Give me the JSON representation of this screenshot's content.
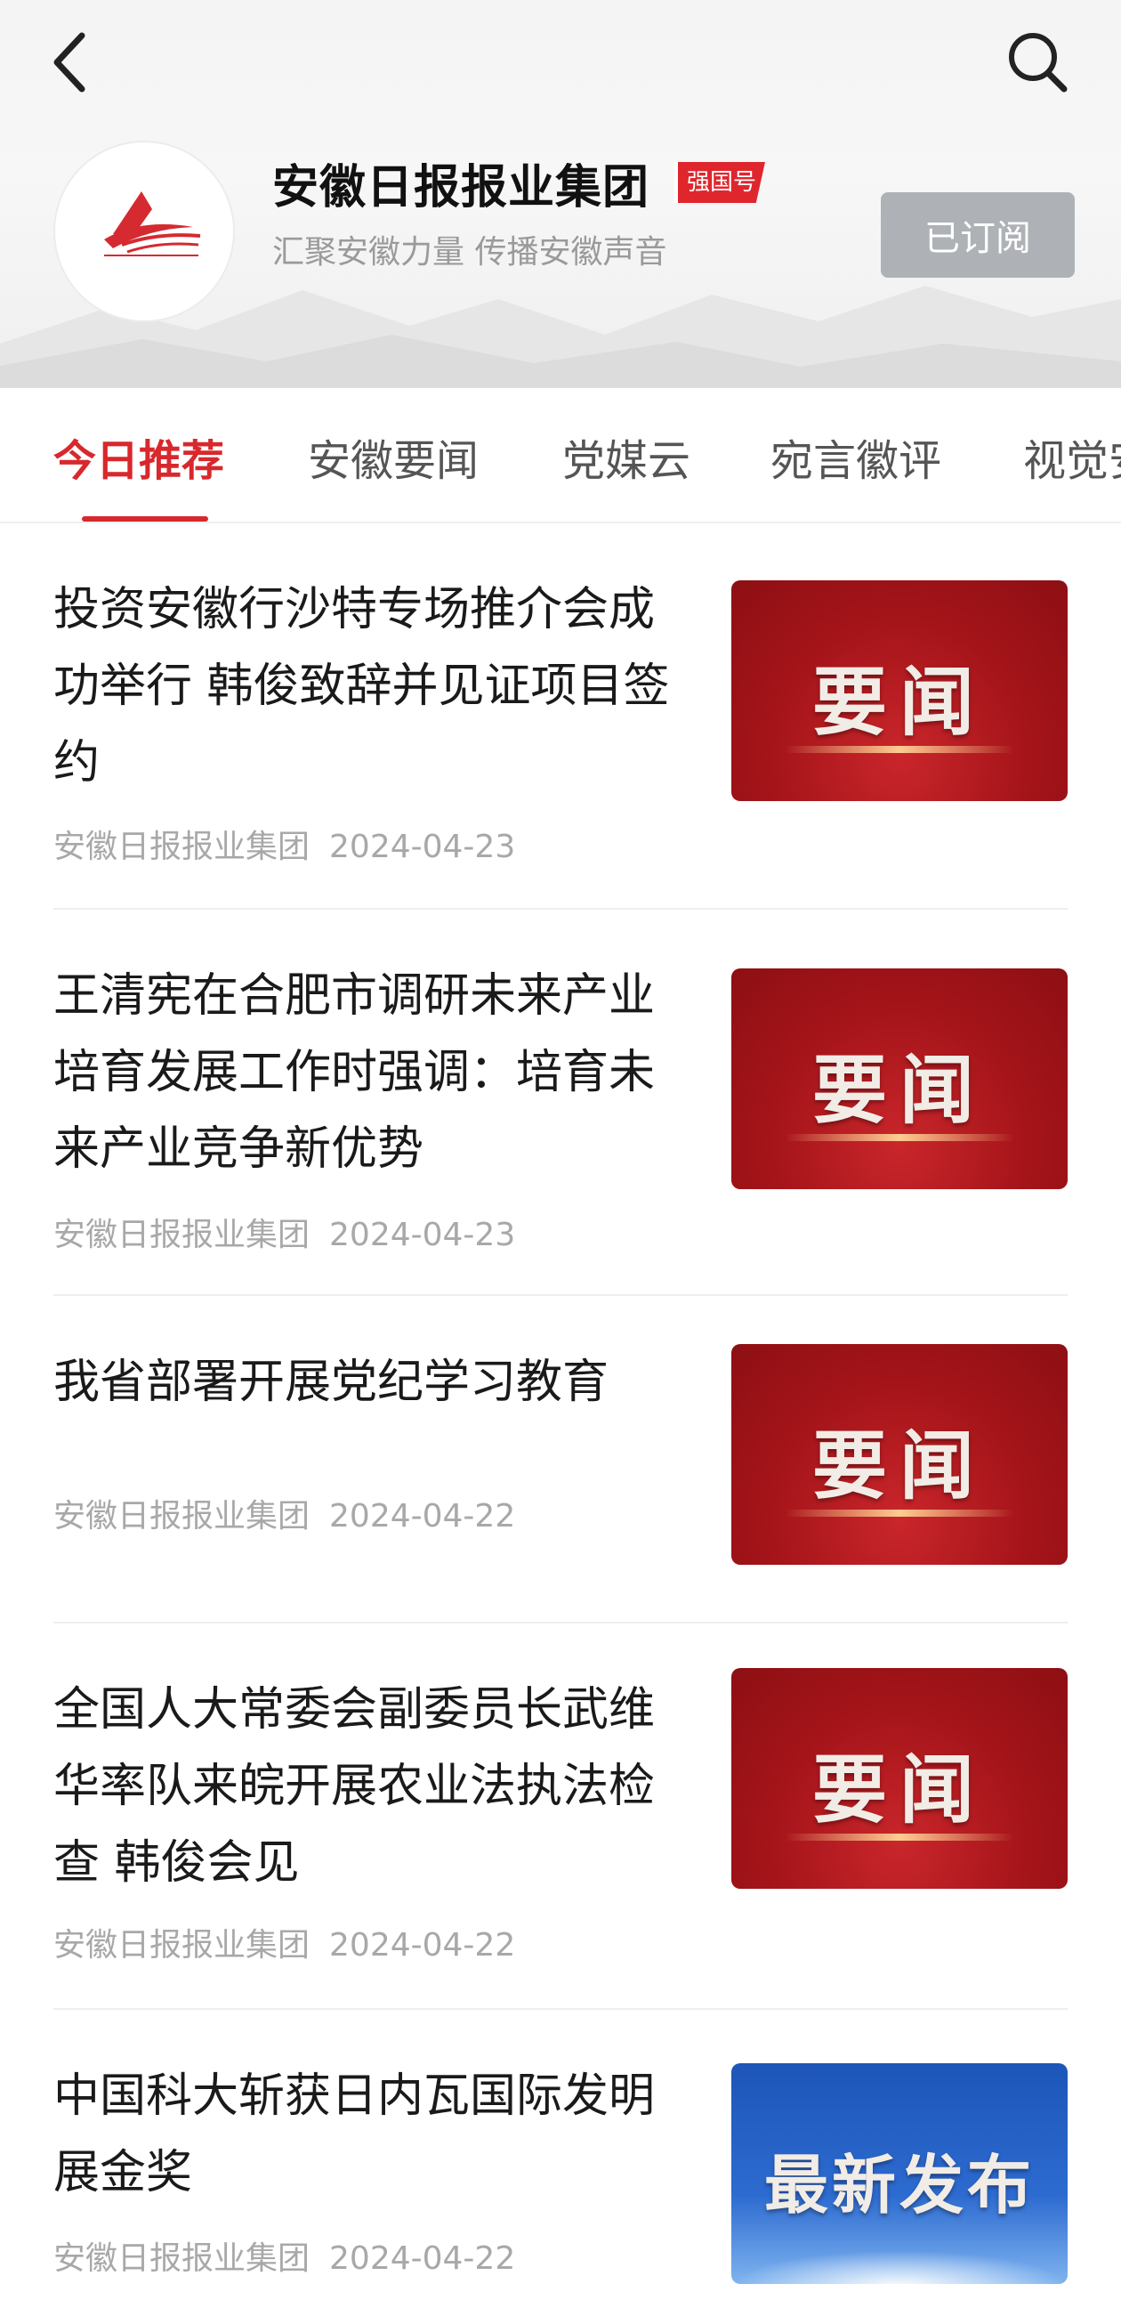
{
  "header": {
    "back_icon": "chevron-left-icon",
    "search_icon": "search-icon",
    "org_name": "安徽日报报业集团",
    "org_badge": "强国号",
    "slogan": "汇聚安徽力量 传播安徽声音",
    "subscribe_label": "已订阅",
    "logo_text": "安徽日报报业集团",
    "accent_color": "#d8282d"
  },
  "tabs": [
    {
      "label": "今日推荐",
      "active": true
    },
    {
      "label": "安徽要闻",
      "active": false
    },
    {
      "label": "党媒云",
      "active": false
    },
    {
      "label": "宛言徽评",
      "active": false
    },
    {
      "label": "视觉安徽",
      "active": false
    }
  ],
  "news": [
    {
      "title": "投资安徽行沙特专场推介会成功举行 韩俊致辞并见证项目签约",
      "source": "安徽日报报业集团",
      "date": "2024-04-23",
      "thumb_label": "要闻",
      "thumb_style": "red"
    },
    {
      "title": "王清宪在合肥市调研未来产业培育发展工作时强调：培育未来产业竞争新优势",
      "source": "安徽日报报业集团",
      "date": "2024-04-23",
      "thumb_label": "要闻",
      "thumb_style": "red"
    },
    {
      "title": "我省部署开展党纪学习教育",
      "source": "安徽日报报业集团",
      "date": "2024-04-22",
      "thumb_label": "要闻",
      "thumb_style": "red"
    },
    {
      "title": "全国人大常委会副委员长武维华率队来皖开展农业法执法检查 韩俊会见",
      "source": "安徽日报报业集团",
      "date": "2024-04-22",
      "thumb_label": "要闻",
      "thumb_style": "red"
    },
    {
      "title": "中国科大斩获日内瓦国际发明展金奖",
      "source": "安徽日报报业集团",
      "date": "2024-04-22",
      "thumb_label": "最新发布",
      "thumb_style": "blue"
    }
  ]
}
